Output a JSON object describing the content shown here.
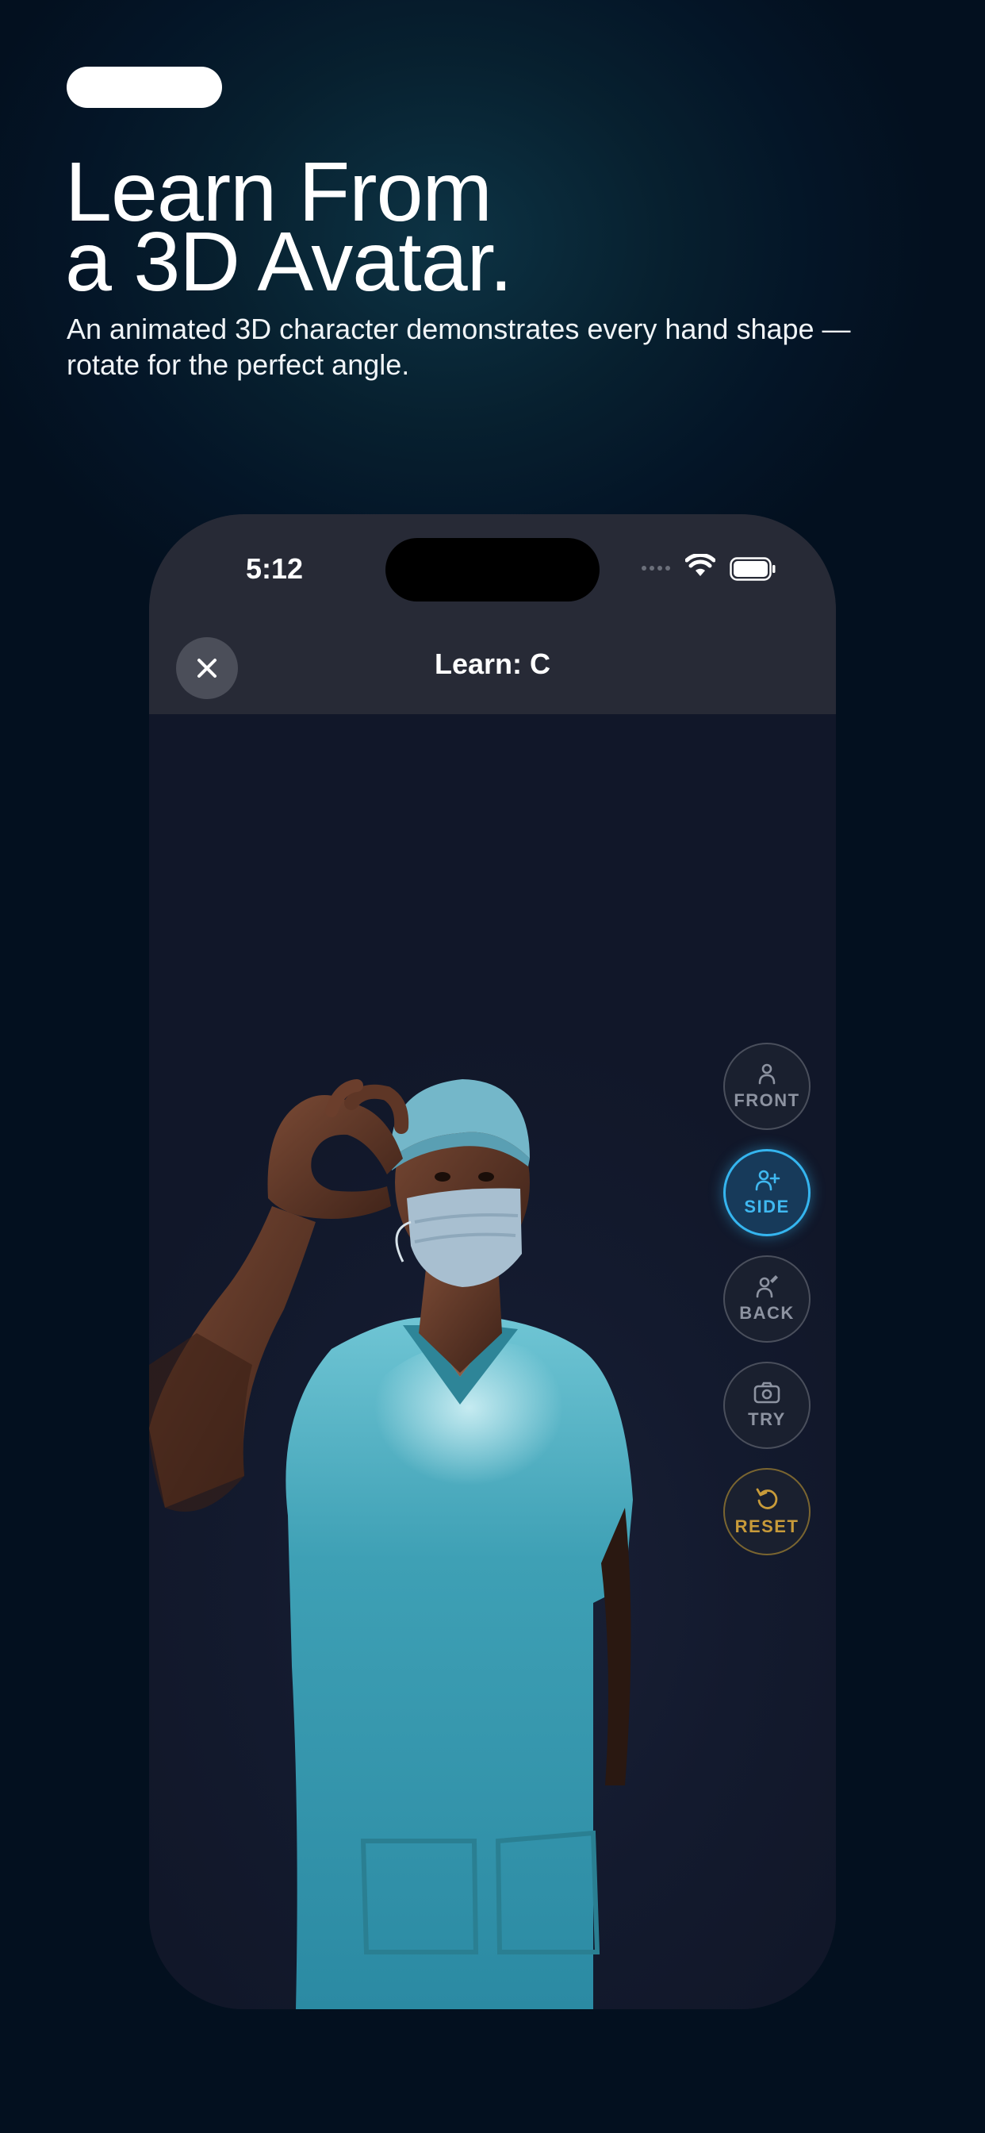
{
  "hero": {
    "headline_line1": "Learn From",
    "headline_line2": "a 3D Avatar.",
    "subtitle": "An animated 3D character demonstrates every hand shape — rotate for the perfect angle."
  },
  "phone": {
    "status_bar": {
      "time": "5:12"
    },
    "nav": {
      "title": "Learn: C",
      "close_icon": "close-icon"
    },
    "view_controls": [
      {
        "label": "FRONT",
        "icon": "person-icon",
        "active": false
      },
      {
        "label": "SIDE",
        "icon": "person-add-icon",
        "active": true
      },
      {
        "label": "BACK",
        "icon": "person-edit-icon",
        "active": false
      },
      {
        "label": "TRY",
        "icon": "camera-icon",
        "active": false
      },
      {
        "label": "RESET",
        "icon": "reset-icon",
        "active": false
      }
    ],
    "colors": {
      "accent_active": "#35b5ef",
      "reset": "#c89b3a",
      "background": "#111729"
    }
  }
}
